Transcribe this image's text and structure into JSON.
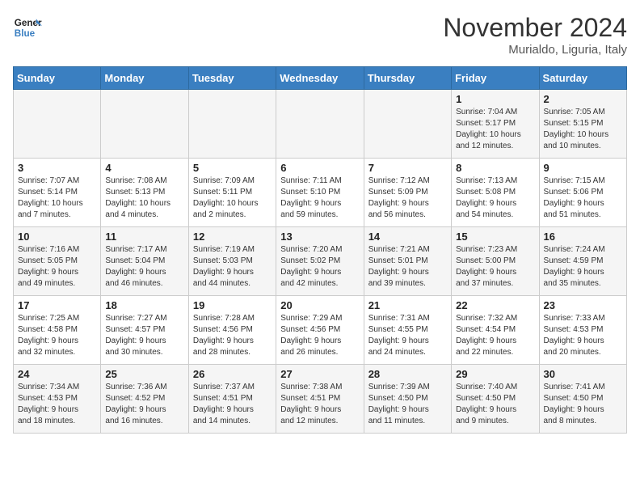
{
  "header": {
    "logo_line1": "General",
    "logo_line2": "Blue",
    "month": "November 2024",
    "location": "Murialdo, Liguria, Italy"
  },
  "weekdays": [
    "Sunday",
    "Monday",
    "Tuesday",
    "Wednesday",
    "Thursday",
    "Friday",
    "Saturday"
  ],
  "weeks": [
    [
      {
        "day": "",
        "info": ""
      },
      {
        "day": "",
        "info": ""
      },
      {
        "day": "",
        "info": ""
      },
      {
        "day": "",
        "info": ""
      },
      {
        "day": "",
        "info": ""
      },
      {
        "day": "1",
        "info": "Sunrise: 7:04 AM\nSunset: 5:17 PM\nDaylight: 10 hours\nand 12 minutes."
      },
      {
        "day": "2",
        "info": "Sunrise: 7:05 AM\nSunset: 5:15 PM\nDaylight: 10 hours\nand 10 minutes."
      }
    ],
    [
      {
        "day": "3",
        "info": "Sunrise: 7:07 AM\nSunset: 5:14 PM\nDaylight: 10 hours\nand 7 minutes."
      },
      {
        "day": "4",
        "info": "Sunrise: 7:08 AM\nSunset: 5:13 PM\nDaylight: 10 hours\nand 4 minutes."
      },
      {
        "day": "5",
        "info": "Sunrise: 7:09 AM\nSunset: 5:11 PM\nDaylight: 10 hours\nand 2 minutes."
      },
      {
        "day": "6",
        "info": "Sunrise: 7:11 AM\nSunset: 5:10 PM\nDaylight: 9 hours\nand 59 minutes."
      },
      {
        "day": "7",
        "info": "Sunrise: 7:12 AM\nSunset: 5:09 PM\nDaylight: 9 hours\nand 56 minutes."
      },
      {
        "day": "8",
        "info": "Sunrise: 7:13 AM\nSunset: 5:08 PM\nDaylight: 9 hours\nand 54 minutes."
      },
      {
        "day": "9",
        "info": "Sunrise: 7:15 AM\nSunset: 5:06 PM\nDaylight: 9 hours\nand 51 minutes."
      }
    ],
    [
      {
        "day": "10",
        "info": "Sunrise: 7:16 AM\nSunset: 5:05 PM\nDaylight: 9 hours\nand 49 minutes."
      },
      {
        "day": "11",
        "info": "Sunrise: 7:17 AM\nSunset: 5:04 PM\nDaylight: 9 hours\nand 46 minutes."
      },
      {
        "day": "12",
        "info": "Sunrise: 7:19 AM\nSunset: 5:03 PM\nDaylight: 9 hours\nand 44 minutes."
      },
      {
        "day": "13",
        "info": "Sunrise: 7:20 AM\nSunset: 5:02 PM\nDaylight: 9 hours\nand 42 minutes."
      },
      {
        "day": "14",
        "info": "Sunrise: 7:21 AM\nSunset: 5:01 PM\nDaylight: 9 hours\nand 39 minutes."
      },
      {
        "day": "15",
        "info": "Sunrise: 7:23 AM\nSunset: 5:00 PM\nDaylight: 9 hours\nand 37 minutes."
      },
      {
        "day": "16",
        "info": "Sunrise: 7:24 AM\nSunset: 4:59 PM\nDaylight: 9 hours\nand 35 minutes."
      }
    ],
    [
      {
        "day": "17",
        "info": "Sunrise: 7:25 AM\nSunset: 4:58 PM\nDaylight: 9 hours\nand 32 minutes."
      },
      {
        "day": "18",
        "info": "Sunrise: 7:27 AM\nSunset: 4:57 PM\nDaylight: 9 hours\nand 30 minutes."
      },
      {
        "day": "19",
        "info": "Sunrise: 7:28 AM\nSunset: 4:56 PM\nDaylight: 9 hours\nand 28 minutes."
      },
      {
        "day": "20",
        "info": "Sunrise: 7:29 AM\nSunset: 4:56 PM\nDaylight: 9 hours\nand 26 minutes."
      },
      {
        "day": "21",
        "info": "Sunrise: 7:31 AM\nSunset: 4:55 PM\nDaylight: 9 hours\nand 24 minutes."
      },
      {
        "day": "22",
        "info": "Sunrise: 7:32 AM\nSunset: 4:54 PM\nDaylight: 9 hours\nand 22 minutes."
      },
      {
        "day": "23",
        "info": "Sunrise: 7:33 AM\nSunset: 4:53 PM\nDaylight: 9 hours\nand 20 minutes."
      }
    ],
    [
      {
        "day": "24",
        "info": "Sunrise: 7:34 AM\nSunset: 4:53 PM\nDaylight: 9 hours\nand 18 minutes."
      },
      {
        "day": "25",
        "info": "Sunrise: 7:36 AM\nSunset: 4:52 PM\nDaylight: 9 hours\nand 16 minutes."
      },
      {
        "day": "26",
        "info": "Sunrise: 7:37 AM\nSunset: 4:51 PM\nDaylight: 9 hours\nand 14 minutes."
      },
      {
        "day": "27",
        "info": "Sunrise: 7:38 AM\nSunset: 4:51 PM\nDaylight: 9 hours\nand 12 minutes."
      },
      {
        "day": "28",
        "info": "Sunrise: 7:39 AM\nSunset: 4:50 PM\nDaylight: 9 hours\nand 11 minutes."
      },
      {
        "day": "29",
        "info": "Sunrise: 7:40 AM\nSunset: 4:50 PM\nDaylight: 9 hours\nand 9 minutes."
      },
      {
        "day": "30",
        "info": "Sunrise: 7:41 AM\nSunset: 4:50 PM\nDaylight: 9 hours\nand 8 minutes."
      }
    ]
  ]
}
